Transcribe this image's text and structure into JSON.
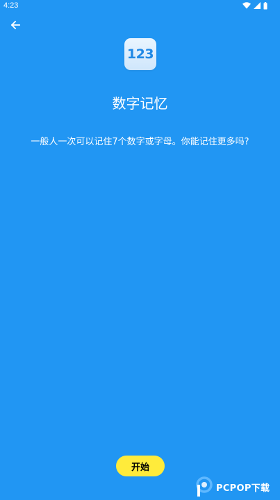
{
  "status_bar": {
    "time": "4:23",
    "icons": [
      "wifi-icon",
      "signal-icon",
      "battery-icon"
    ]
  },
  "header": {
    "back_icon": "arrow-left-icon"
  },
  "app_icon": {
    "label": "123"
  },
  "main": {
    "title": "数字记忆",
    "description": "一般人一次可以记住7个数字或字母。你能记住更多吗?"
  },
  "actions": {
    "start_label": "开始"
  },
  "watermark": {
    "text": "PCPOP下载"
  },
  "colors": {
    "background": "#2196F3",
    "button": "#FFEB3B",
    "icon_text": "#1F88E5"
  }
}
